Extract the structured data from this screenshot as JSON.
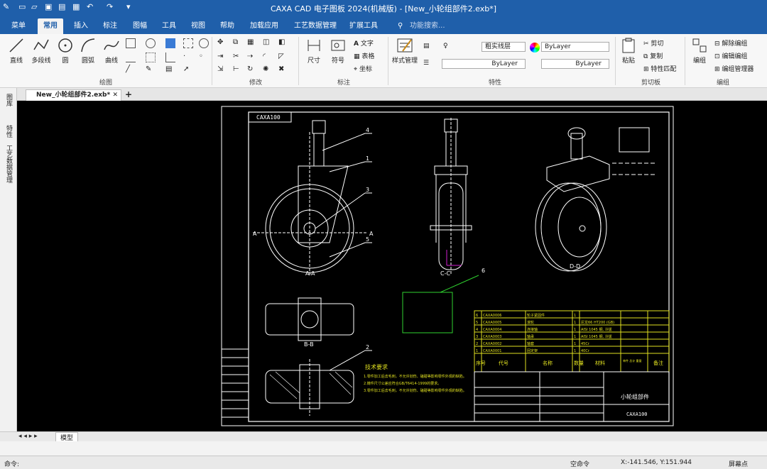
{
  "app": {
    "title": "CAXA CAD 电子图板 2024(机械版) - [New_小轮组部件2.exb*]"
  },
  "menu": {
    "tabs": [
      "菜单",
      "常用",
      "插入",
      "标注",
      "图幅",
      "工具",
      "视图",
      "帮助",
      "加载应用",
      "工艺数据管理",
      "扩展工具"
    ],
    "search": "功能搜索..."
  },
  "ribbon": {
    "draw": {
      "label": "绘图",
      "line": "直线",
      "polyline": "多段线",
      "circle": "圆",
      "arc": "圆弧",
      "curve": "曲线"
    },
    "modify": {
      "label": "修改"
    },
    "dimension": {
      "label": "标注",
      "size": "尺寸",
      "symbol": "符号",
      "text": "文字",
      "table": "表格",
      "coord": "坐标"
    },
    "style": {
      "label": "特性",
      "manager": "样式管理",
      "layer": "粗实线层",
      "color": "ByLayer",
      "linetype": "ByLayer",
      "lineweight": "ByLayer"
    },
    "clipboard": {
      "label": "剪切板",
      "paste": "粘贴",
      "cut": "剪切",
      "copy": "复制",
      "match": "特性匹配"
    },
    "group": {
      "label": "编组",
      "edit": "编组",
      "ungroup": "解除编组",
      "editgroup": "编辑编组",
      "manager": "编组管理器"
    }
  },
  "doc": {
    "tab": "New_小轮组部件2.exb*",
    "plus": "+"
  },
  "side": {
    "p1": "图库",
    "p2": "特性",
    "p3": "工艺数据管理"
  },
  "bottom": {
    "model": "模型"
  },
  "status": {
    "cmd": "命令:",
    "state": "空命令",
    "coords": "X:-141.546, Y:151.944",
    "snap": "屏幕点"
  },
  "drawing": {
    "title_code": "CAXA100",
    "part_name": "小轮组部件",
    "parts_code": "CAXA100",
    "tech_title": "技术要求",
    "tech_lines": [
      "1.零件加工后去毛刺，不允许划伤、磕碰等影响零件外观的缺陷。",
      "2.铸件尺寸公差应符合GB/T6414-1999的要求。",
      "3.零件加工后去毛刺，不允许划伤、磕碰等影响零件外观的缺陷。"
    ],
    "bom": [
      [
        "6",
        "CAXA0006",
        "轮子紧固件",
        "1",
        "",
        "",
        ""
      ],
      [
        "5",
        "CAXA0005",
        "滚轮",
        "1",
        "尼龙66 HT200 (GB)",
        "",
        ""
      ],
      [
        "4",
        "CAXA0004",
        "连接轴",
        "1",
        "AISI 1045 钢, 冷拔",
        "",
        ""
      ],
      [
        "3",
        "CAXA0003",
        "轴承",
        "1",
        "AISI 1045 钢, 冷拔",
        "",
        ""
      ],
      [
        "2",
        "CAXA0002",
        "轴套",
        "1",
        "45Cr",
        "",
        ""
      ],
      [
        "1",
        "CAXA0001",
        "固定架",
        "1",
        "40Cr",
        "",
        ""
      ]
    ],
    "bom_header": [
      "序号",
      "代号",
      "名称",
      "数量",
      "材料",
      "单件 总计 重量",
      "备注"
    ],
    "balloons": [
      "4",
      "1",
      "3",
      "5",
      "2",
      "6"
    ],
    "section_labels": [
      "A-A",
      "C-C",
      "D-D",
      "B-B"
    ],
    "side_a": "A"
  }
}
